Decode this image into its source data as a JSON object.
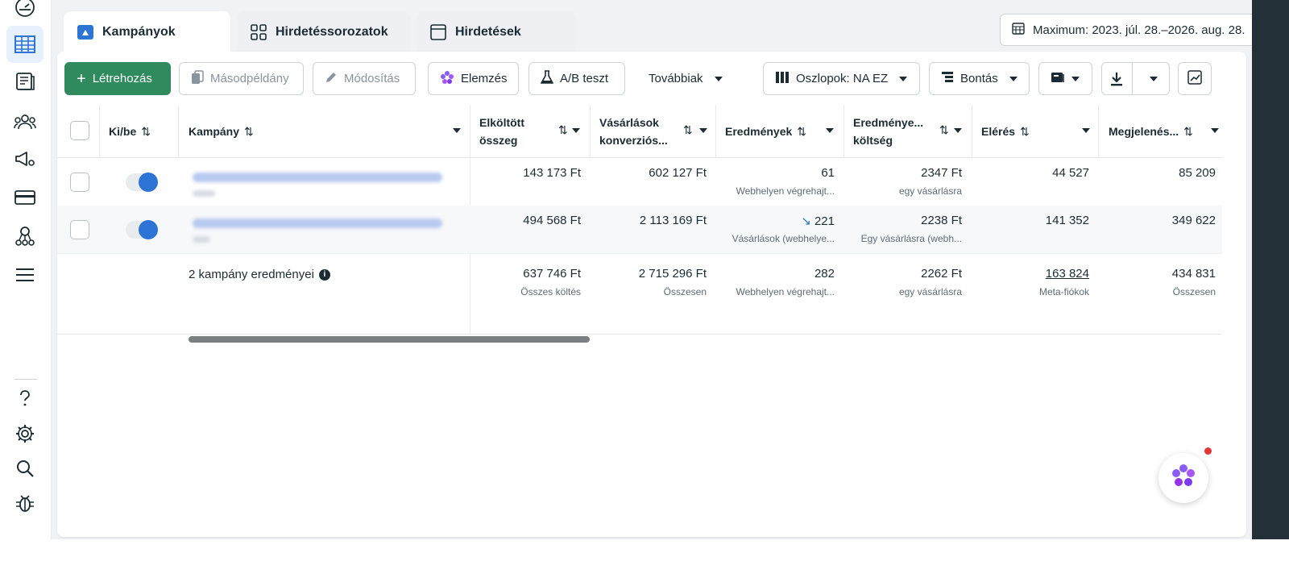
{
  "tabs": [
    {
      "label": "Kampányok",
      "icon": "campaign-folder-icon",
      "active": true
    },
    {
      "label": "Hirdetéssorozatok",
      "icon": "adset-grid-icon",
      "active": false
    },
    {
      "label": "Hirdetések",
      "icon": "ad-window-icon",
      "active": false
    }
  ],
  "date_range": "Maximum: 2023. júl. 28.–2026. aug. 28.",
  "toolbar": {
    "create": "Létrehozás",
    "duplicate": "Másodpéldány",
    "edit": "Módosítás",
    "analyze": "Elemzés",
    "ab_test": "A/B teszt",
    "more": "Továbbiak",
    "columns": "Oszlopok: NA EZ",
    "breakdown": "Bontás"
  },
  "table": {
    "headers": {
      "onoff": "Ki/be",
      "campaign": "Kampány",
      "spent_line1": "Elköltött",
      "spent_line2": "összeg",
      "purchases_line1": "Vásárlások",
      "purchases_line2": "konverziós...",
      "results": "Eredmények",
      "cost_line1": "Eredménye...",
      "cost_line2": "költség",
      "reach": "Elérés",
      "impressions": "Megjelenés..."
    },
    "rows": [
      {
        "spent": "143 173 Ft",
        "purchases": "602 127 Ft",
        "results": "61",
        "results_sub": "Webhelyen végrehajt...",
        "cost": "2347 Ft",
        "cost_sub": "egy vásárlásra",
        "reach": "44 527",
        "impressions": "85 209"
      },
      {
        "spent": "494 568 Ft",
        "purchases": "2 113 169 Ft",
        "results": "221",
        "results_sub": "Vásárlások (webhelye...",
        "cost": "2238 Ft",
        "cost_sub": "Egy vásárlásra (webh...",
        "reach": "141 352",
        "impressions": "349 622"
      }
    ],
    "summary": {
      "label": "2 kampány eredményei",
      "spent": "637 746 Ft",
      "spent_sub": "Összes költés",
      "purchases": "2 715 296 Ft",
      "purchases_sub": "Összesen",
      "results": "282",
      "results_sub": "Webhelyen végrehajt...",
      "cost": "2262 Ft",
      "cost_sub": "egy vásárlásra",
      "reach": "163 824",
      "reach_sub": "Meta-fiókok",
      "impressions": "434 831",
      "impressions_sub": "Összesen"
    }
  },
  "colors": {
    "create_button": "#2f8a5d",
    "toggle_on": "#2d74d4",
    "active_nav": "#e7f0fd"
  }
}
